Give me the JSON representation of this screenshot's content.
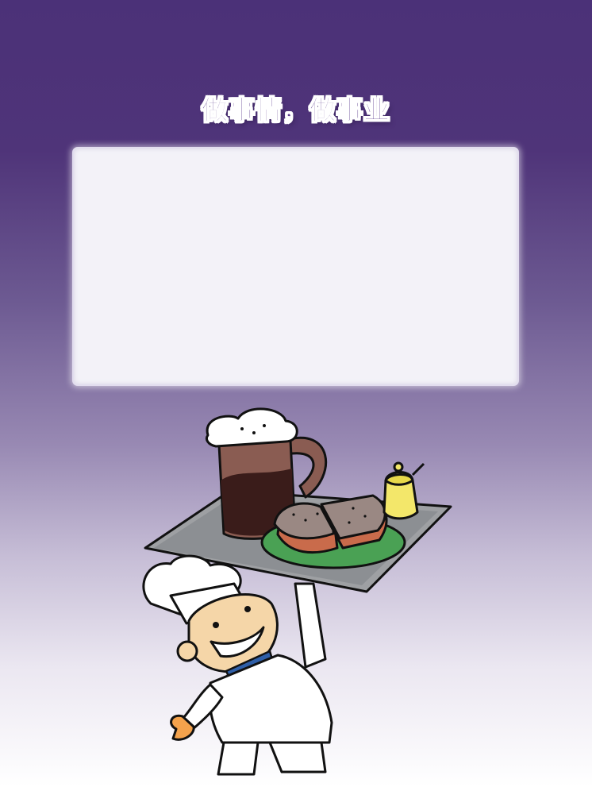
{
  "title": "做事情，做事业",
  "content_panel": {
    "text": ""
  },
  "illustration": {
    "icon": "chef-with-tray-icon",
    "items": [
      "beer-mug-icon",
      "sandwich-icon",
      "mustard-pot-icon",
      "tray-icon"
    ]
  },
  "colors": {
    "background_top": "#4b3178",
    "background_bottom": "#ffffff",
    "panel": "#f3f2f8",
    "title_text": "#5b3a8c"
  }
}
